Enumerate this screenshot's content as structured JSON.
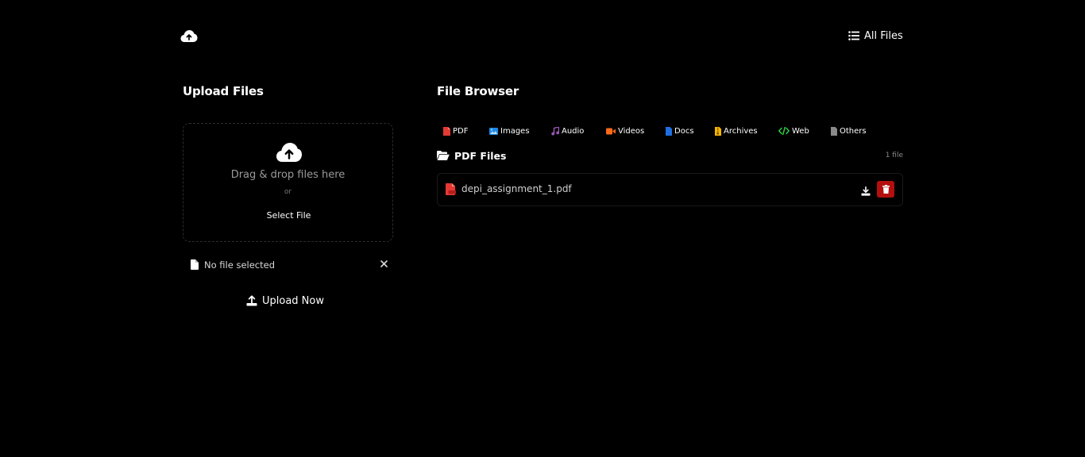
{
  "header": {
    "logo_icon": "cloud-upload-icon",
    "all_files_label": "All Files"
  },
  "upload": {
    "title": "Upload Files",
    "dropzone_text": "Drag & drop files here",
    "or_text": "or",
    "select_label": "Select File",
    "no_file_text": "No file selected",
    "upload_button_label": "Upload Now"
  },
  "browser": {
    "title": "File Browser",
    "tabs": [
      {
        "label": "PDF",
        "icon": "pdf-icon",
        "color": "#e53935"
      },
      {
        "label": "Images",
        "icon": "image-icon",
        "color": "#1e88e5"
      },
      {
        "label": "Audio",
        "icon": "music-icon",
        "color": "#8e44ad"
      },
      {
        "label": "Videos",
        "icon": "video-icon",
        "color": "#fb6a18"
      },
      {
        "label": "Docs",
        "icon": "doc-icon",
        "color": "#1e6fe0"
      },
      {
        "label": "Archives",
        "icon": "archive-icon",
        "color": "#f5b400"
      },
      {
        "label": "Web",
        "icon": "code-icon",
        "color": "#2ecc40"
      },
      {
        "label": "Others",
        "icon": "file-icon",
        "color": "#8a8a8a"
      }
    ],
    "section_title": "PDF Files",
    "count": "1 file",
    "files": [
      {
        "name": "depi_assignment_1.pdf"
      }
    ]
  },
  "colors": {
    "background": "#000000",
    "delete": "#b30f0f"
  }
}
